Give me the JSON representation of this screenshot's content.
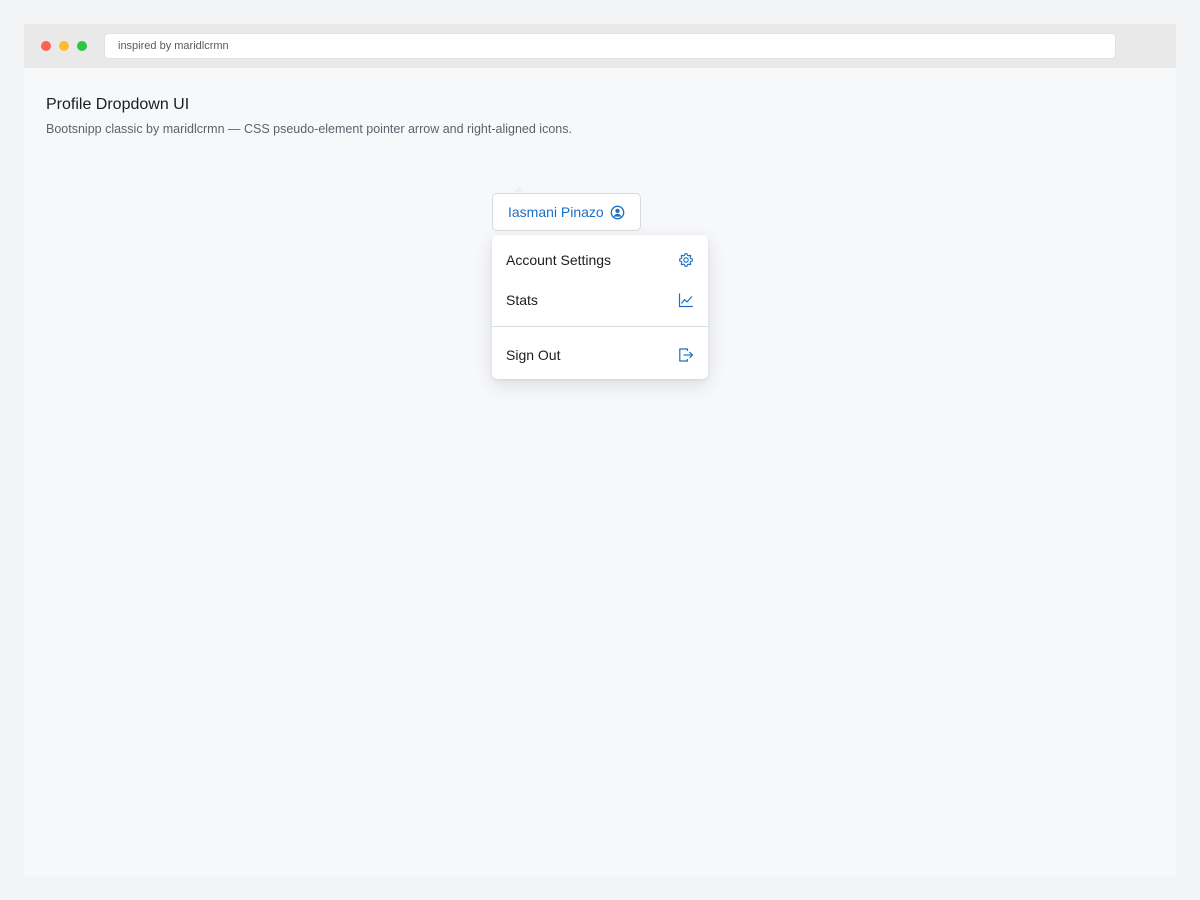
{
  "browser": {
    "address": "inspired by maridlcrmn"
  },
  "page": {
    "title": "Profile Dropdown UI",
    "subtitle": "Bootsnipp classic by maridlcrmn — CSS pseudo-element pointer arrow and right-aligned icons."
  },
  "profile": {
    "name": "Iasmani Pinazo",
    "icon": "user-circle-icon"
  },
  "menu": {
    "items": [
      {
        "label": "Account Settings",
        "icon": "gear-icon"
      },
      {
        "label": "Stats",
        "icon": "line-chart-icon"
      },
      {
        "label": "Sign Out",
        "icon": "sign-out-icon"
      }
    ]
  },
  "colors": {
    "accent": "#1a6fc4",
    "text": "#1a1d21",
    "muted": "#5d636b"
  }
}
